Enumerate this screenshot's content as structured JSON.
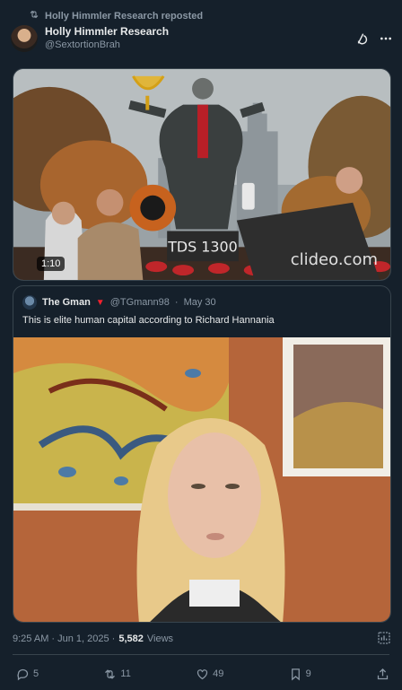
{
  "repost": {
    "text": "Holly Himmler Research reposted"
  },
  "author": {
    "display_name": "Holly Himmler Research",
    "handle": "@SextortionBrah"
  },
  "media": {
    "duration": "1:10",
    "statue_plaque": "TDS 1300",
    "watermark": "clideo.com"
  },
  "quote": {
    "display_name": "The Gman",
    "handle": "@TGmann98",
    "separator": "·",
    "date": "May 30",
    "text": "This is elite human capital according to Richard Hannania"
  },
  "meta": {
    "time": "9:25 AM · Jun 1, 2025 ·",
    "views_count": "5,582",
    "views_label": "Views"
  },
  "actions": {
    "replies": "5",
    "reposts": "11",
    "likes": "49",
    "bookmarks": "9"
  },
  "colors": {
    "background": "#15202b",
    "border": "#38444d",
    "muted": "#8b98a5",
    "text": "#e7e9ea",
    "accent_red": "#f4212e"
  },
  "icons": [
    "repost-icon",
    "grok-icon",
    "more-icon",
    "analytics-icon",
    "reply-icon",
    "like-icon",
    "bookmark-icon",
    "share-icon"
  ]
}
